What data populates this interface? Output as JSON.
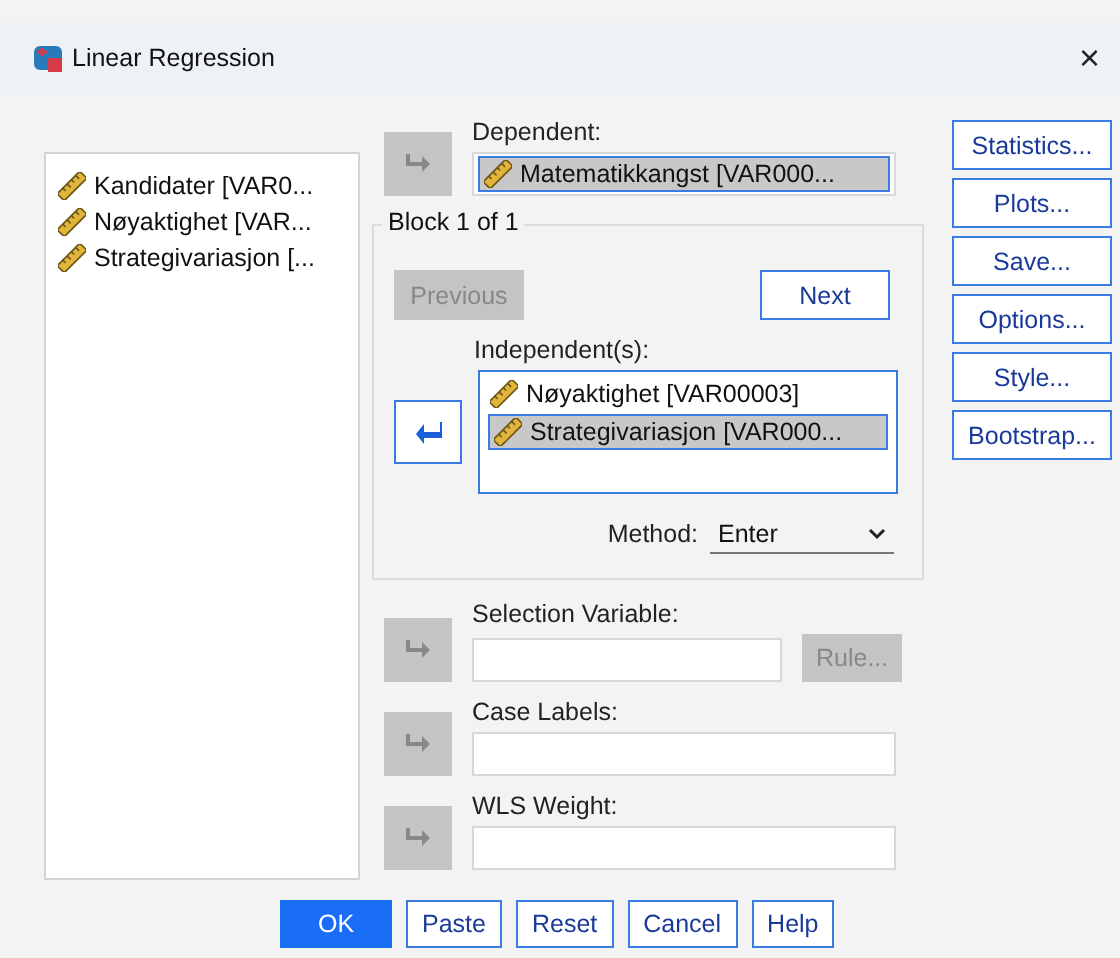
{
  "window": {
    "title": "Linear Regression",
    "close": "×"
  },
  "variables": [
    {
      "name": "Kandidater [VAR0...",
      "selected": false
    },
    {
      "name": "Nøyaktighet [VAR...",
      "selected": false
    },
    {
      "name": "Strategivariasjon [...",
      "selected": false
    }
  ],
  "dependent": {
    "label": "Dependent:",
    "arrow": {
      "disabled": true,
      "kind": "add"
    },
    "items": [
      {
        "name": "Matematikkangst [VAR000...",
        "selected": true
      }
    ]
  },
  "block": {
    "legend": "Block 1 of 1",
    "previous": {
      "label": "Previous",
      "disabled": true
    },
    "next": {
      "label": "Next",
      "disabled": false
    },
    "independent": {
      "label": "Independent(s):",
      "arrow": {
        "disabled": false,
        "kind": "remove"
      },
      "items": [
        {
          "name": "Nøyaktighet [VAR00003]",
          "selected": false
        },
        {
          "name": "Strategivariasjon [VAR000...",
          "selected": true
        }
      ]
    },
    "method": {
      "label": "Method:",
      "value": "Enter"
    }
  },
  "fields": [
    {
      "label": "Selection Variable:",
      "arrow": {
        "disabled": true,
        "kind": "add"
      },
      "rule": {
        "label": "Rule...",
        "disabled": true
      }
    },
    {
      "label": "Case Labels:",
      "arrow": {
        "disabled": true,
        "kind": "add"
      }
    },
    {
      "label": "WLS Weight:",
      "arrow": {
        "disabled": true,
        "kind": "add"
      }
    }
  ],
  "side_buttons": [
    {
      "label": "Statistics..."
    },
    {
      "label": "Plots..."
    },
    {
      "label": "Save..."
    },
    {
      "label": "Options..."
    },
    {
      "label": "Style..."
    },
    {
      "label": "Bootstrap..."
    }
  ],
  "footer_buttons": [
    {
      "label": "OK",
      "default": true
    },
    {
      "label": "Paste",
      "default": false
    },
    {
      "label": "Reset",
      "default": false
    },
    {
      "label": "Cancel",
      "default": false
    },
    {
      "label": "Help",
      "default": false
    }
  ]
}
